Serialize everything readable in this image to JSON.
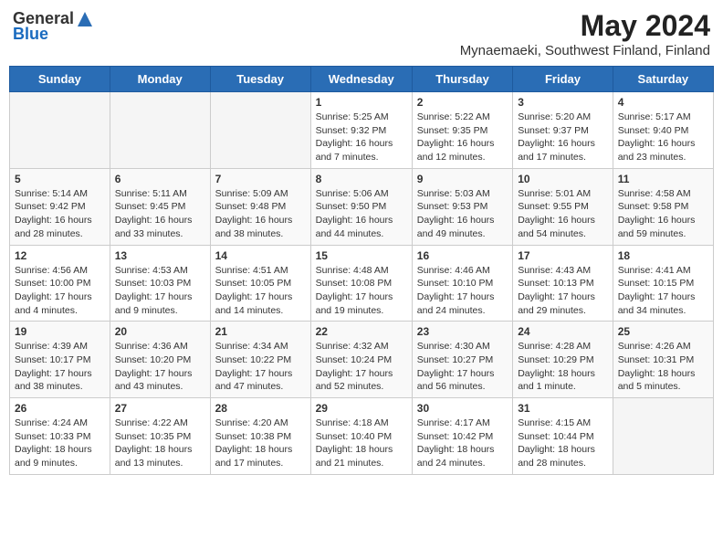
{
  "header": {
    "logo_general": "General",
    "logo_blue": "Blue",
    "month_title": "May 2024",
    "location": "Mynaemaeki, Southwest Finland, Finland"
  },
  "days_of_week": [
    "Sunday",
    "Monday",
    "Tuesday",
    "Wednesday",
    "Thursday",
    "Friday",
    "Saturday"
  ],
  "weeks": [
    {
      "days": [
        {
          "number": "",
          "info": ""
        },
        {
          "number": "",
          "info": ""
        },
        {
          "number": "",
          "info": ""
        },
        {
          "number": "1",
          "info": "Sunrise: 5:25 AM\nSunset: 9:32 PM\nDaylight: 16 hours\nand 7 minutes."
        },
        {
          "number": "2",
          "info": "Sunrise: 5:22 AM\nSunset: 9:35 PM\nDaylight: 16 hours\nand 12 minutes."
        },
        {
          "number": "3",
          "info": "Sunrise: 5:20 AM\nSunset: 9:37 PM\nDaylight: 16 hours\nand 17 minutes."
        },
        {
          "number": "4",
          "info": "Sunrise: 5:17 AM\nSunset: 9:40 PM\nDaylight: 16 hours\nand 23 minutes."
        }
      ]
    },
    {
      "days": [
        {
          "number": "5",
          "info": "Sunrise: 5:14 AM\nSunset: 9:42 PM\nDaylight: 16 hours\nand 28 minutes."
        },
        {
          "number": "6",
          "info": "Sunrise: 5:11 AM\nSunset: 9:45 PM\nDaylight: 16 hours\nand 33 minutes."
        },
        {
          "number": "7",
          "info": "Sunrise: 5:09 AM\nSunset: 9:48 PM\nDaylight: 16 hours\nand 38 minutes."
        },
        {
          "number": "8",
          "info": "Sunrise: 5:06 AM\nSunset: 9:50 PM\nDaylight: 16 hours\nand 44 minutes."
        },
        {
          "number": "9",
          "info": "Sunrise: 5:03 AM\nSunset: 9:53 PM\nDaylight: 16 hours\nand 49 minutes."
        },
        {
          "number": "10",
          "info": "Sunrise: 5:01 AM\nSunset: 9:55 PM\nDaylight: 16 hours\nand 54 minutes."
        },
        {
          "number": "11",
          "info": "Sunrise: 4:58 AM\nSunset: 9:58 PM\nDaylight: 16 hours\nand 59 minutes."
        }
      ]
    },
    {
      "days": [
        {
          "number": "12",
          "info": "Sunrise: 4:56 AM\nSunset: 10:00 PM\nDaylight: 17 hours\nand 4 minutes."
        },
        {
          "number": "13",
          "info": "Sunrise: 4:53 AM\nSunset: 10:03 PM\nDaylight: 17 hours\nand 9 minutes."
        },
        {
          "number": "14",
          "info": "Sunrise: 4:51 AM\nSunset: 10:05 PM\nDaylight: 17 hours\nand 14 minutes."
        },
        {
          "number": "15",
          "info": "Sunrise: 4:48 AM\nSunset: 10:08 PM\nDaylight: 17 hours\nand 19 minutes."
        },
        {
          "number": "16",
          "info": "Sunrise: 4:46 AM\nSunset: 10:10 PM\nDaylight: 17 hours\nand 24 minutes."
        },
        {
          "number": "17",
          "info": "Sunrise: 4:43 AM\nSunset: 10:13 PM\nDaylight: 17 hours\nand 29 minutes."
        },
        {
          "number": "18",
          "info": "Sunrise: 4:41 AM\nSunset: 10:15 PM\nDaylight: 17 hours\nand 34 minutes."
        }
      ]
    },
    {
      "days": [
        {
          "number": "19",
          "info": "Sunrise: 4:39 AM\nSunset: 10:17 PM\nDaylight: 17 hours\nand 38 minutes."
        },
        {
          "number": "20",
          "info": "Sunrise: 4:36 AM\nSunset: 10:20 PM\nDaylight: 17 hours\nand 43 minutes."
        },
        {
          "number": "21",
          "info": "Sunrise: 4:34 AM\nSunset: 10:22 PM\nDaylight: 17 hours\nand 47 minutes."
        },
        {
          "number": "22",
          "info": "Sunrise: 4:32 AM\nSunset: 10:24 PM\nDaylight: 17 hours\nand 52 minutes."
        },
        {
          "number": "23",
          "info": "Sunrise: 4:30 AM\nSunset: 10:27 PM\nDaylight: 17 hours\nand 56 minutes."
        },
        {
          "number": "24",
          "info": "Sunrise: 4:28 AM\nSunset: 10:29 PM\nDaylight: 18 hours\nand 1 minute."
        },
        {
          "number": "25",
          "info": "Sunrise: 4:26 AM\nSunset: 10:31 PM\nDaylight: 18 hours\nand 5 minutes."
        }
      ]
    },
    {
      "days": [
        {
          "number": "26",
          "info": "Sunrise: 4:24 AM\nSunset: 10:33 PM\nDaylight: 18 hours\nand 9 minutes."
        },
        {
          "number": "27",
          "info": "Sunrise: 4:22 AM\nSunset: 10:35 PM\nDaylight: 18 hours\nand 13 minutes."
        },
        {
          "number": "28",
          "info": "Sunrise: 4:20 AM\nSunset: 10:38 PM\nDaylight: 18 hours\nand 17 minutes."
        },
        {
          "number": "29",
          "info": "Sunrise: 4:18 AM\nSunset: 10:40 PM\nDaylight: 18 hours\nand 21 minutes."
        },
        {
          "number": "30",
          "info": "Sunrise: 4:17 AM\nSunset: 10:42 PM\nDaylight: 18 hours\nand 24 minutes."
        },
        {
          "number": "31",
          "info": "Sunrise: 4:15 AM\nSunset: 10:44 PM\nDaylight: 18 hours\nand 28 minutes."
        },
        {
          "number": "",
          "info": ""
        }
      ]
    }
  ]
}
